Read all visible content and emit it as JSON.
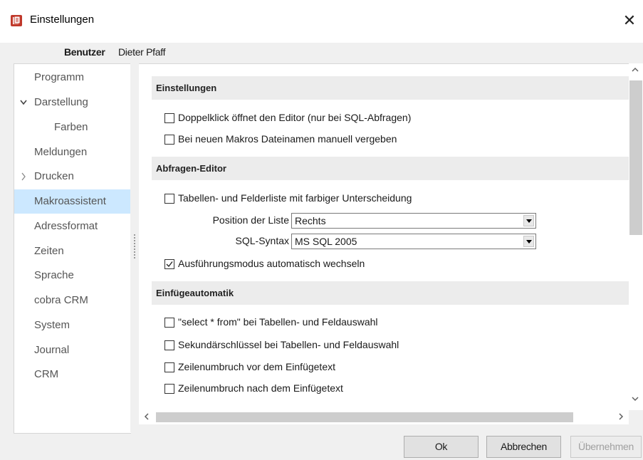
{
  "window": {
    "title": "Einstellungen",
    "close_glyph": "✕"
  },
  "user": {
    "label": "Benutzer",
    "name": "Dieter Pfaff"
  },
  "nav": {
    "items": [
      {
        "label": "Programm"
      },
      {
        "label": "Darstellung",
        "arrow": "expanded"
      },
      {
        "label": "Farben",
        "sub": true
      },
      {
        "label": "Meldungen"
      },
      {
        "label": "Drucken",
        "arrow": "collapsed"
      },
      {
        "label": "Makroassistent",
        "selected": true
      },
      {
        "label": "Adressformat"
      },
      {
        "label": "Zeiten"
      },
      {
        "label": "Sprache"
      },
      {
        "label": "cobra CRM"
      },
      {
        "label": "System"
      },
      {
        "label": "Journal"
      },
      {
        "label": "CRM"
      }
    ]
  },
  "sections": {
    "einstellungen": {
      "title": "Einstellungen",
      "options": [
        {
          "label": "Doppelklick öffnet den Editor (nur bei SQL-Abfragen)",
          "checked": false
        },
        {
          "label": "Bei neuen Makros Dateinamen manuell vergeben",
          "checked": false
        }
      ]
    },
    "abfragen_editor": {
      "title": "Abfragen-Editor",
      "option_farbig": {
        "label": "Tabellen- und Felderliste mit farbiger Unterscheidung",
        "checked": false
      },
      "position_label": "Position der Liste",
      "position_value": "Rechts",
      "syntax_label": "SQL-Syntax",
      "syntax_value": "MS SQL 2005",
      "option_modus": {
        "label": "Ausführungsmodus automatisch wechseln",
        "checked": true
      }
    },
    "einfuegeautomatik": {
      "title": "Einfügeautomatik",
      "options": [
        {
          "label": "\"select * from\" bei Tabellen- und Feldauswahl",
          "checked": false
        },
        {
          "label": "Sekundärschlüssel bei Tabellen- und Feldauswahl",
          "checked": false
        },
        {
          "label": "Zeilenumbruch vor dem Einfügetext",
          "checked": false
        },
        {
          "label": "Zeilenumbruch nach dem Einfügetext",
          "checked": false
        }
      ]
    }
  },
  "buttons": {
    "ok": "Ok",
    "cancel": "Abbrechen",
    "apply": "Übernehmen"
  },
  "colors": {
    "selection": "#cce8ff",
    "section_header": "#ececec",
    "app_icon": "#c0392b"
  }
}
